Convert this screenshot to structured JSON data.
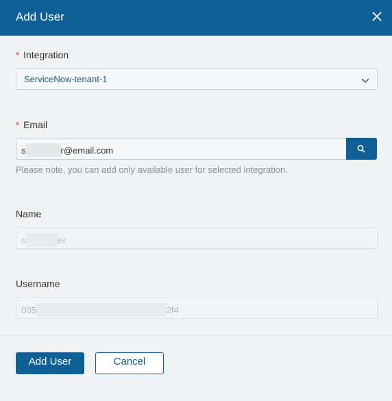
{
  "dialog": {
    "title": "Add User",
    "close_icon": "close-icon"
  },
  "form": {
    "integration": {
      "label": "Integration",
      "required_mark": "*",
      "selected": "ServiceNow-tenant-1",
      "icon": "chevron-down-icon"
    },
    "email": {
      "label": "Email",
      "required_mark": "*",
      "value_prefix": "s",
      "value_suffix": "r@email.com",
      "search_icon": "search-icon",
      "hint": "Please note, you can add only available user for selected integration."
    },
    "name": {
      "label": "Name",
      "value_prefix": "s",
      "value_suffix": "er"
    },
    "username": {
      "label": "Username",
      "value_prefix": "005",
      "value_suffix": "2f4"
    }
  },
  "footer": {
    "add_label": "Add User",
    "cancel_label": "Cancel"
  },
  "colors": {
    "header": "#0e5f96",
    "required": "#d9342b",
    "link": "#1f5a86"
  }
}
